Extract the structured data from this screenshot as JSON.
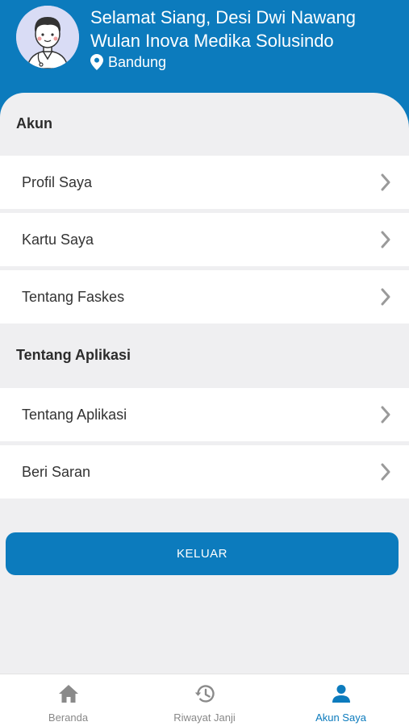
{
  "header": {
    "greeting": "Selamat Siang, Desi Dwi Nawang Wulan Inova Medika Solusindo",
    "location": "Bandung"
  },
  "sections": {
    "akun": {
      "title": "Akun",
      "items": [
        "Profil Saya",
        "Kartu Saya",
        "Tentang Faskes"
      ]
    },
    "aplikasi": {
      "title": "Tentang Aplikasi",
      "items": [
        "Tentang Aplikasi",
        "Beri Saran"
      ]
    }
  },
  "logout_label": "KELUAR",
  "tabs": [
    {
      "label": "Beranda",
      "icon": "home-icon",
      "active": false
    },
    {
      "label": "Riwayat Janji",
      "icon": "history-icon",
      "active": false
    },
    {
      "label": "Akun Saya",
      "icon": "person-icon",
      "active": true
    }
  ],
  "colors": {
    "primary": "#0c7bbd",
    "background": "#efeff1",
    "inactive": "#888888",
    "chevron": "#9a9a9a"
  }
}
